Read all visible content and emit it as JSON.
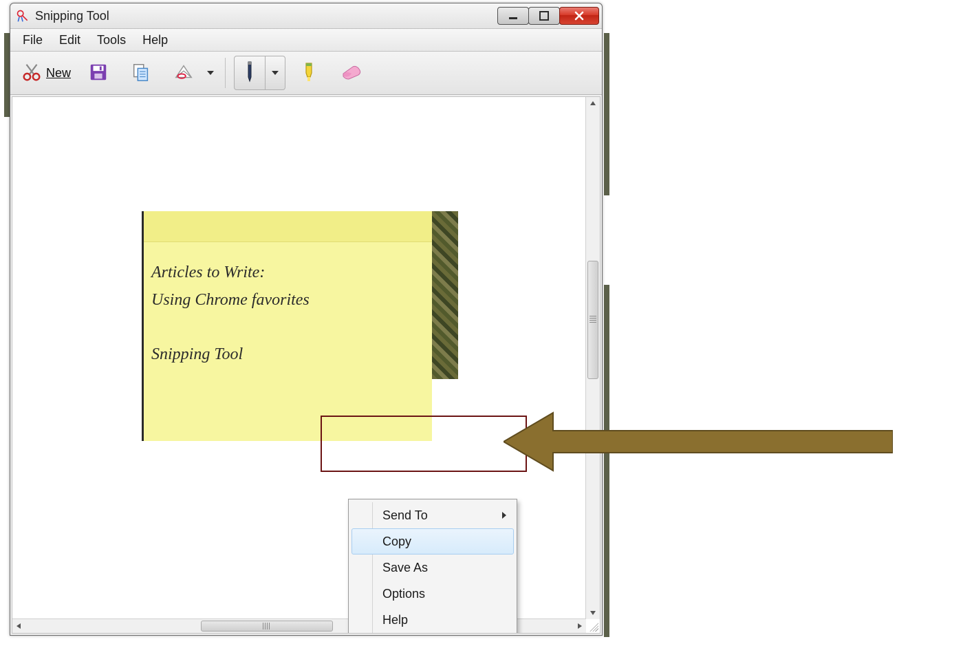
{
  "titlebar": {
    "title": "Snipping Tool"
  },
  "menubar": [
    "File",
    "Edit",
    "Tools",
    "Help"
  ],
  "toolbar": {
    "new_label": "New"
  },
  "snip": {
    "line1": "Articles to Write:",
    "line2": "Using Chrome favorites",
    "line3": "Snipping Tool"
  },
  "context_menu": {
    "items": [
      {
        "label": "Send To",
        "submenu": true,
        "hover": false
      },
      {
        "label": "Copy",
        "submenu": false,
        "hover": true
      },
      {
        "label": "Save As",
        "submenu": false,
        "hover": false
      },
      {
        "label": "Options",
        "submenu": false,
        "hover": false
      },
      {
        "label": "Help",
        "submenu": false,
        "hover": false
      }
    ]
  }
}
